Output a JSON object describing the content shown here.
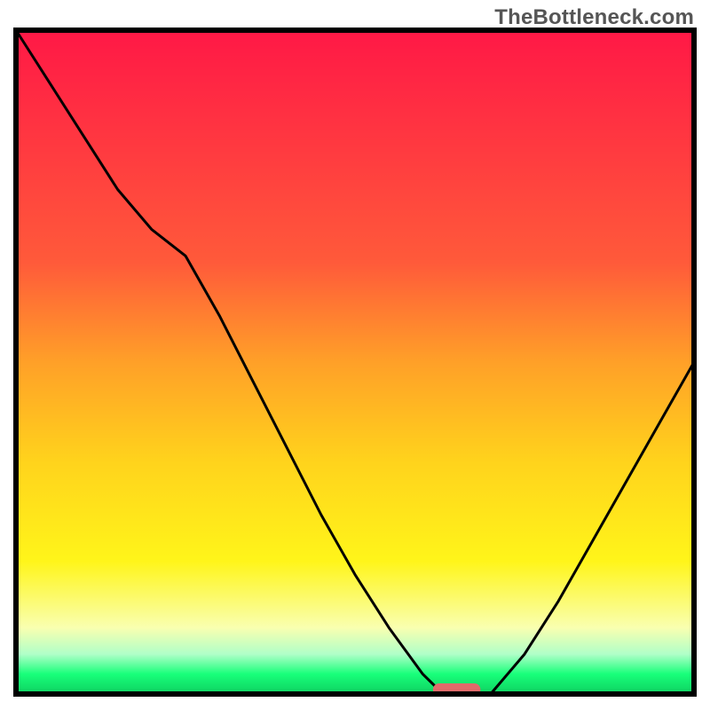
{
  "watermark": "TheBottleneck.com",
  "colors": {
    "top": "#ff1846",
    "mid1": "#ff5a3a",
    "mid2": "#ffa028",
    "mid3": "#ffd31c",
    "mid4": "#fff51a",
    "mid5": "#f9ffb0",
    "bottom1": "#b0ffc8",
    "bottom2": "#18ff7a",
    "bottom3": "#0ed060",
    "marker": "#e06a6a",
    "markerStroke": "#a83a3a",
    "curve": "#000000",
    "frame": "#000000",
    "background": "#ffffff"
  },
  "chart_data": {
    "type": "line",
    "title": "",
    "xlabel": "",
    "ylabel": "",
    "x": [
      0.0,
      0.05,
      0.1,
      0.15,
      0.2,
      0.25,
      0.3,
      0.35,
      0.4,
      0.45,
      0.5,
      0.55,
      0.6,
      0.63,
      0.67,
      0.7,
      0.75,
      0.8,
      0.85,
      0.9,
      0.95,
      1.0
    ],
    "values": [
      100,
      92,
      84,
      76,
      70,
      66,
      57,
      47,
      37,
      27,
      18,
      10,
      3,
      0,
      0,
      0,
      6,
      14,
      23,
      32,
      41,
      50
    ],
    "xlim": [
      0,
      1
    ],
    "ylim": [
      0,
      100
    ],
    "optimal_marker": {
      "x_start": 0.615,
      "x_end": 0.685,
      "y": 0
    }
  }
}
